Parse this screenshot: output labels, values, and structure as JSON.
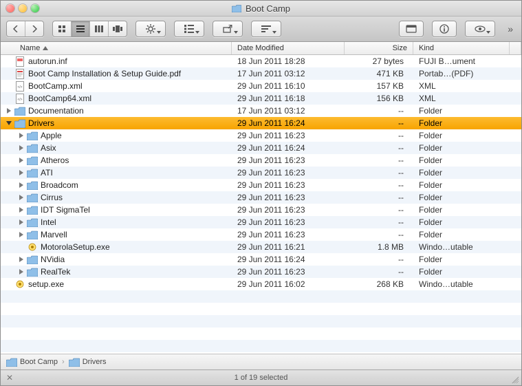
{
  "window": {
    "title": "Boot Camp"
  },
  "toolbar": {
    "back_tip": "Back",
    "forward_tip": "Forward",
    "view_icon_tip": "Icon View",
    "view_list_tip": "List View",
    "view_column_tip": "Column View",
    "view_cover_tip": "Cover Flow",
    "action_tip": "Action",
    "arrange_tip": "Arrange",
    "share_tip": "Share",
    "edit_tags_tip": "Edit Tags",
    "quicklook_tip": "Quick Look",
    "info_tip": "Get Info",
    "preview_tip": "Show/Hide Preview"
  },
  "columns": {
    "name": "Name",
    "date": "Date Modified",
    "size": "Size",
    "kind": "Kind"
  },
  "rows": [
    {
      "depth": 0,
      "expandable": false,
      "expanded": false,
      "selected": false,
      "icon": "file-inf",
      "name": "autorun.inf",
      "date": "18 Jun 2011 18:28",
      "size": "27 bytes",
      "kind": "FUJI B…ument"
    },
    {
      "depth": 0,
      "expandable": false,
      "expanded": false,
      "selected": false,
      "icon": "file-pdf",
      "name": "Boot Camp Installation & Setup Guide.pdf",
      "date": "17 Jun 2011 03:12",
      "size": "471 KB",
      "kind": "Portab…(PDF)"
    },
    {
      "depth": 0,
      "expandable": false,
      "expanded": false,
      "selected": false,
      "icon": "file-xml",
      "name": "BootCamp.xml",
      "date": "29 Jun 2011 16:10",
      "size": "157 KB",
      "kind": "XML"
    },
    {
      "depth": 0,
      "expandable": false,
      "expanded": false,
      "selected": false,
      "icon": "file-xml",
      "name": "BootCamp64.xml",
      "date": "29 Jun 2011 16:18",
      "size": "156 KB",
      "kind": "XML"
    },
    {
      "depth": 0,
      "expandable": true,
      "expanded": false,
      "selected": false,
      "icon": "folder",
      "name": "Documentation",
      "date": "17 Jun 2011 03:12",
      "size": "--",
      "kind": "Folder"
    },
    {
      "depth": 0,
      "expandable": true,
      "expanded": true,
      "selected": true,
      "icon": "folder",
      "name": "Drivers",
      "date": "29 Jun 2011 16:24",
      "size": "--",
      "kind": "Folder"
    },
    {
      "depth": 1,
      "expandable": true,
      "expanded": false,
      "selected": false,
      "icon": "folder",
      "name": "Apple",
      "date": "29 Jun 2011 16:23",
      "size": "--",
      "kind": "Folder"
    },
    {
      "depth": 1,
      "expandable": true,
      "expanded": false,
      "selected": false,
      "icon": "folder",
      "name": "Asix",
      "date": "29 Jun 2011 16:24",
      "size": "--",
      "kind": "Folder"
    },
    {
      "depth": 1,
      "expandable": true,
      "expanded": false,
      "selected": false,
      "icon": "folder",
      "name": "Atheros",
      "date": "29 Jun 2011 16:23",
      "size": "--",
      "kind": "Folder"
    },
    {
      "depth": 1,
      "expandable": true,
      "expanded": false,
      "selected": false,
      "icon": "folder",
      "name": "ATI",
      "date": "29 Jun 2011 16:23",
      "size": "--",
      "kind": "Folder"
    },
    {
      "depth": 1,
      "expandable": true,
      "expanded": false,
      "selected": false,
      "icon": "folder",
      "name": "Broadcom",
      "date": "29 Jun 2011 16:23",
      "size": "--",
      "kind": "Folder"
    },
    {
      "depth": 1,
      "expandable": true,
      "expanded": false,
      "selected": false,
      "icon": "folder",
      "name": "Cirrus",
      "date": "29 Jun 2011 16:23",
      "size": "--",
      "kind": "Folder"
    },
    {
      "depth": 1,
      "expandable": true,
      "expanded": false,
      "selected": false,
      "icon": "folder",
      "name": "IDT SigmaTel",
      "date": "29 Jun 2011 16:23",
      "size": "--",
      "kind": "Folder"
    },
    {
      "depth": 1,
      "expandable": true,
      "expanded": false,
      "selected": false,
      "icon": "folder",
      "name": "Intel",
      "date": "29 Jun 2011 16:23",
      "size": "--",
      "kind": "Folder"
    },
    {
      "depth": 1,
      "expandable": true,
      "expanded": false,
      "selected": false,
      "icon": "folder",
      "name": "Marvell",
      "date": "29 Jun 2011 16:23",
      "size": "--",
      "kind": "Folder"
    },
    {
      "depth": 1,
      "expandable": false,
      "expanded": false,
      "selected": false,
      "icon": "file-exe",
      "name": "MotorolaSetup.exe",
      "date": "29 Jun 2011 16:21",
      "size": "1.8 MB",
      "kind": "Windo…utable"
    },
    {
      "depth": 1,
      "expandable": true,
      "expanded": false,
      "selected": false,
      "icon": "folder",
      "name": "NVidia",
      "date": "29 Jun 2011 16:24",
      "size": "--",
      "kind": "Folder"
    },
    {
      "depth": 1,
      "expandable": true,
      "expanded": false,
      "selected": false,
      "icon": "folder",
      "name": "RealTek",
      "date": "29 Jun 2011 16:23",
      "size": "--",
      "kind": "Folder"
    },
    {
      "depth": 0,
      "expandable": false,
      "expanded": false,
      "selected": false,
      "icon": "file-exe",
      "name": "setup.exe",
      "date": "29 Jun 2011 16:02",
      "size": "268 KB",
      "kind": "Windo…utable"
    }
  ],
  "path": [
    {
      "icon": "folder",
      "label": "Boot Camp"
    },
    {
      "icon": "folder",
      "label": "Drivers"
    }
  ],
  "status": {
    "text": "1 of 19 selected"
  }
}
